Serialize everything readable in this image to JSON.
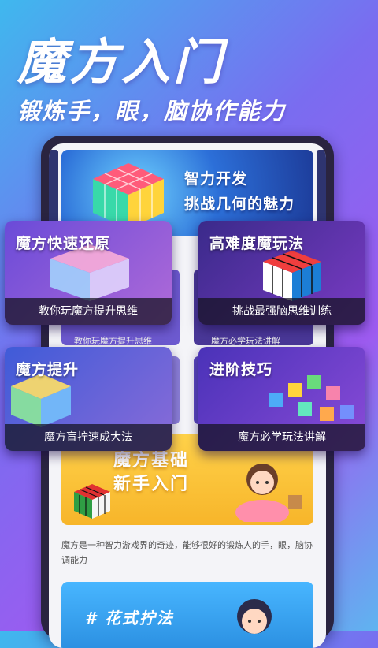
{
  "hero": {
    "title": "魔方入门",
    "subtitle": "锻炼手，眼，脑协作能力"
  },
  "phone_banner": {
    "line1": "智力开发",
    "line2": "挑战几何的魅力"
  },
  "cards": [
    {
      "title": "魔方快速还原",
      "caption": "教你玩魔方提升思维",
      "bg_from": "#6a4bd8",
      "bg_to": "#b06ad8"
    },
    {
      "title": "高难度魔玩法",
      "caption": "挑战最强脑思维训练",
      "bg_from": "#3a2a8a",
      "bg_to": "#7a3bc4"
    },
    {
      "title": "魔方提升",
      "caption": "魔方盲拧速成大法",
      "bg_from": "#3f5bd8",
      "bg_to": "#8a6bd8"
    },
    {
      "title": "进阶技巧",
      "caption": "魔方必学玩法讲解",
      "bg_from": "#4a32b8",
      "bg_to": "#8a4bd8"
    }
  ],
  "under_cards": {
    "label_left": "教你玩魔方提升思维",
    "label_right": "魔方必学玩法讲解"
  },
  "basics": {
    "line1": "魔方基础",
    "line2": "新手入门"
  },
  "description": "魔方是一种智力游戏界的奇迹，能够很好的锻炼人的手，眼，脑协调能力",
  "bottom_card": {
    "title": "# 花式拧法"
  },
  "colors": {
    "accent_purple": "#7a6cf0",
    "accent_blue": "#3fb8ee",
    "basics_yellow": "#ffd24a"
  }
}
